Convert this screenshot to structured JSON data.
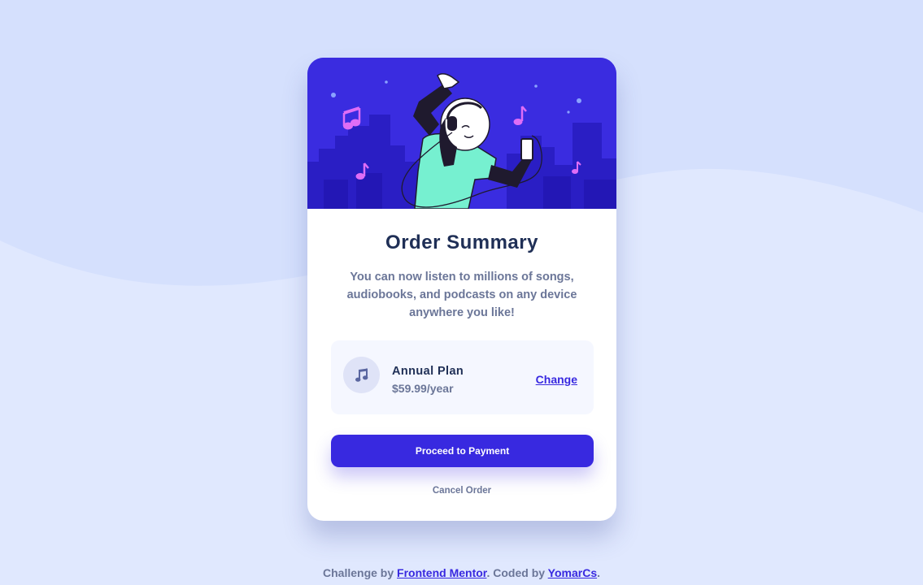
{
  "card": {
    "title": "Order Summary",
    "description": "You can now listen to millions of songs, audiobooks, and podcasts on any device anywhere you like!",
    "plan": {
      "name": "Annual Plan",
      "price": "$59.99/year",
      "icon": "music-note-icon",
      "change_label": "Change"
    },
    "proceed_label": "Proceed to Payment",
    "cancel_label": "Cancel Order"
  },
  "attribution": {
    "prefix": "Challenge by ",
    "challenge_link": "Frontend Mentor",
    "middle": ". Coded by ",
    "author_link": "YomarCs",
    "suffix": "."
  },
  "colors": {
    "background": "#e0e8fe",
    "wave": "#d5e0fd",
    "hero": "#3a2ce0",
    "accent": "#3829e0",
    "title": "#1f2f56",
    "muted": "#6b7698",
    "plan_bg": "#f5f7ff"
  }
}
